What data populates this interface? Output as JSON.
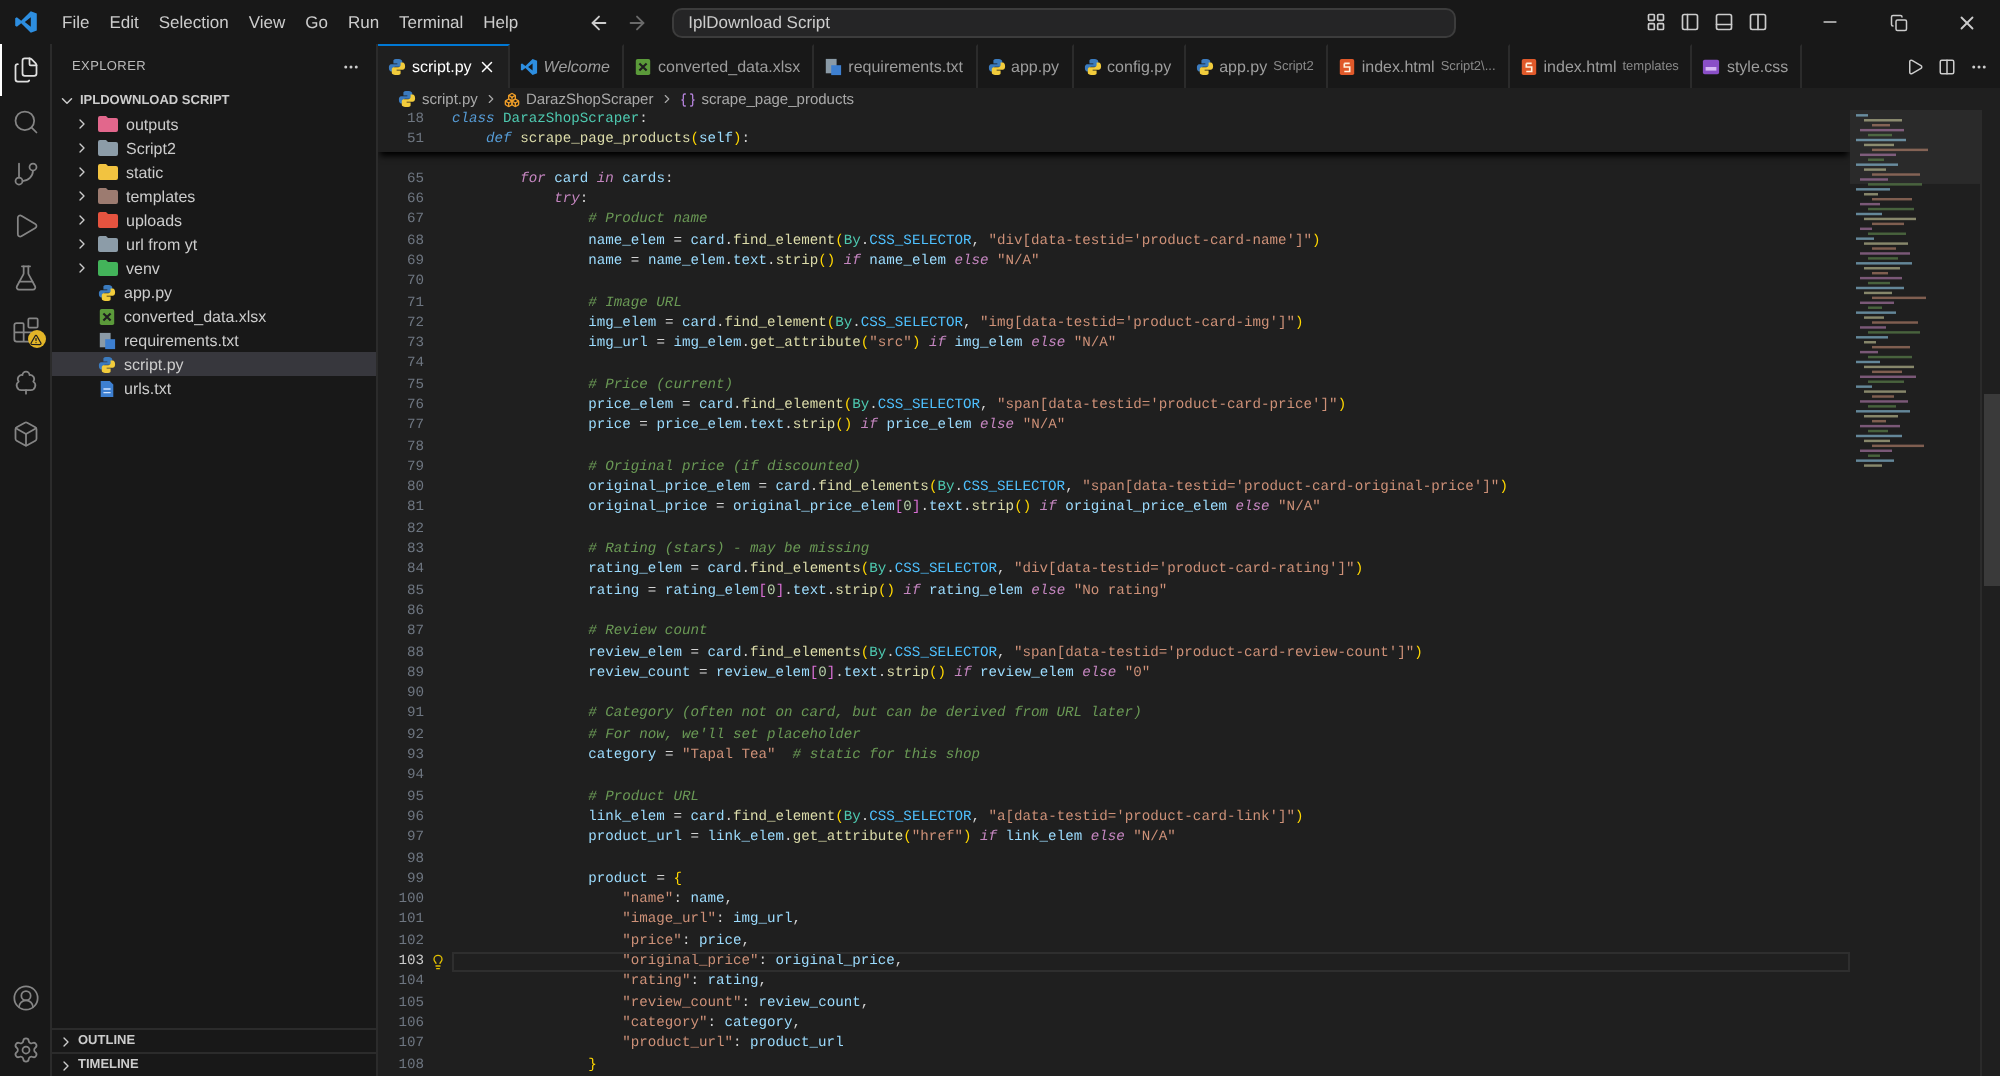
{
  "title_bar": {
    "menu": [
      "File",
      "Edit",
      "Selection",
      "View",
      "Go",
      "Run",
      "Terminal",
      "Help"
    ],
    "search": {
      "value": "IplDownload Script"
    }
  },
  "activity_bar": {
    "items": [
      {
        "kind": "explorer",
        "selected": true,
        "warning": false
      },
      {
        "kind": "search",
        "selected": false,
        "warning": false
      },
      {
        "kind": "source_control",
        "selected": false,
        "warning": false
      },
      {
        "kind": "run",
        "selected": false,
        "warning": false
      },
      {
        "kind": "testing",
        "selected": false,
        "warning": false
      },
      {
        "kind": "extensions",
        "selected": false,
        "warning": true
      },
      {
        "kind": "remote",
        "selected": false,
        "warning": false
      },
      {
        "kind": "packages",
        "selected": false,
        "warning": false
      }
    ],
    "bottom": [
      {
        "kind": "account"
      },
      {
        "kind": "settings"
      }
    ]
  },
  "sidebar": {
    "title": "EXPLORER",
    "root": {
      "label": "IPLDOWNLOAD SCRIPT",
      "expanded": true,
      "children": [
        {
          "label": "outputs",
          "kind": "folder",
          "color": "#e2678c",
          "expanded": false,
          "selected": false
        },
        {
          "label": "Script2",
          "kind": "folder",
          "color": "#8c9ca8",
          "expanded": false,
          "selected": false
        },
        {
          "label": "static",
          "kind": "folder",
          "color": "#f2c340",
          "expanded": false,
          "selected": false
        },
        {
          "label": "templates",
          "kind": "folder",
          "color": "#9c7b70",
          "expanded": false,
          "selected": false
        },
        {
          "label": "uploads",
          "kind": "folder",
          "color": "#e5533f",
          "expanded": false,
          "selected": false
        },
        {
          "label": "url from yt",
          "kind": "folder",
          "color": "#8c9ca8",
          "expanded": false,
          "selected": false
        },
        {
          "label": "venv",
          "kind": "folder",
          "color": "#43b35a",
          "expanded": false,
          "selected": false
        },
        {
          "label": "app.py",
          "kind": "python",
          "selected": false
        },
        {
          "label": "converted_data.xlsx",
          "kind": "sheet",
          "selected": false
        },
        {
          "label": "requirements.txt",
          "kind": "text",
          "selected": false
        },
        {
          "label": "script.py",
          "kind": "python",
          "selected": true
        },
        {
          "label": "urls.txt",
          "kind": "doc",
          "selected": false
        }
      ]
    },
    "sections": [
      {
        "label": "OUTLINE",
        "expanded": false
      },
      {
        "label": "TIMELINE",
        "expanded": false
      }
    ]
  },
  "tabs": [
    {
      "label": "script.py",
      "kind": "python",
      "selected": true,
      "preview": false
    },
    {
      "label": "Welcome",
      "kind": "vscode",
      "selected": false,
      "preview": true
    },
    {
      "label": "converted_data.xlsx",
      "kind": "sheet",
      "selected": false,
      "preview": false
    },
    {
      "label": "requirements.txt",
      "kind": "text",
      "selected": false,
      "preview": false
    },
    {
      "label": "app.py",
      "kind": "python",
      "selected": false,
      "preview": false
    },
    {
      "label": "config.py",
      "kind": "python",
      "selected": false,
      "preview": false
    },
    {
      "label": "app.py",
      "description": "Script2",
      "kind": "python",
      "selected": false,
      "preview": false
    },
    {
      "label": "index.html",
      "description": "Script2\\...",
      "kind": "html",
      "selected": false,
      "preview": false
    },
    {
      "label": "index.html",
      "description": "templates",
      "kind": "html",
      "selected": false,
      "preview": false
    },
    {
      "label": "style.css",
      "kind": "css",
      "selected": false,
      "preview": false
    }
  ],
  "breadcrumb": [
    {
      "label": "script.py",
      "kind": "file"
    },
    {
      "label": "DarazShopScraper",
      "kind": "class"
    },
    {
      "label": "scrape_page_products",
      "kind": "method"
    }
  ],
  "editor": {
    "sticky_lines": [
      {
        "number": "18",
        "tokens": [
          {
            "kind": "st",
            "text": "class"
          },
          {
            "kind": "cls",
            "text": " DarazShopScraper"
          },
          {
            "kind": "p",
            "text": ":"
          }
        ]
      },
      {
        "number": "51",
        "tokens": [
          {
            "kind": "st",
            "text": "    def"
          },
          {
            "kind": "fn",
            "text": " scrape_page_products"
          },
          {
            "kind": "b",
            "text": "("
          },
          {
            "kind": "var",
            "text": "self"
          },
          {
            "kind": "b",
            "text": ")"
          },
          {
            "kind": "p",
            "text": ":"
          }
        ]
      }
    ],
    "lines": [
      {
        "number": "65",
        "current": false,
        "tokens": [
          {
            "kind": "kw",
            "text": "        for"
          },
          {
            "kind": "var",
            "text": " card "
          },
          {
            "kind": "kw",
            "text": "in"
          },
          {
            "kind": "var",
            "text": " cards"
          },
          {
            "kind": "p",
            "text": ":"
          }
        ]
      },
      {
        "number": "66",
        "current": false,
        "tokens": [
          {
            "kind": "kw",
            "text": "            try"
          },
          {
            "kind": "p",
            "text": ":"
          }
        ]
      },
      {
        "number": "67",
        "current": false,
        "tokens": [
          {
            "kind": "c",
            "text": "                # Product name"
          }
        ]
      },
      {
        "number": "68",
        "current": false,
        "tokens": [
          {
            "kind": "var",
            "text": "                name_elem"
          },
          {
            "kind": "p",
            "text": " = "
          },
          {
            "kind": "var",
            "text": "card"
          },
          {
            "kind": "p",
            "text": "."
          },
          {
            "kind": "fn",
            "text": "find_element"
          },
          {
            "kind": "b",
            "text": "("
          },
          {
            "kind": "cls",
            "text": "By"
          },
          {
            "kind": "p",
            "text": "."
          },
          {
            "kind": "const",
            "text": "CSS_SELECTOR"
          },
          {
            "kind": "p",
            "text": ", "
          },
          {
            "kind": "s",
            "text": "\"div[data-testid='product-card-name']\""
          },
          {
            "kind": "b",
            "text": ")"
          }
        ]
      },
      {
        "number": "69",
        "current": false,
        "tokens": [
          {
            "kind": "var",
            "text": "                name"
          },
          {
            "kind": "p",
            "text": " = "
          },
          {
            "kind": "var",
            "text": "name_elem"
          },
          {
            "kind": "p",
            "text": "."
          },
          {
            "kind": "var",
            "text": "text"
          },
          {
            "kind": "p",
            "text": "."
          },
          {
            "kind": "fn",
            "text": "strip"
          },
          {
            "kind": "b",
            "text": "()"
          },
          {
            "kind": "kw",
            "text": " if"
          },
          {
            "kind": "var",
            "text": " name_elem "
          },
          {
            "kind": "kw",
            "text": "else"
          },
          {
            "kind": "s",
            "text": " \"N/A\""
          }
        ]
      },
      {
        "number": "70",
        "current": false
      },
      {
        "number": "71",
        "current": false,
        "tokens": [
          {
            "kind": "c",
            "text": "                # Image URL"
          }
        ]
      },
      {
        "number": "72",
        "current": false,
        "tokens": [
          {
            "kind": "var",
            "text": "                img_elem"
          },
          {
            "kind": "p",
            "text": " = "
          },
          {
            "kind": "var",
            "text": "card"
          },
          {
            "kind": "p",
            "text": "."
          },
          {
            "kind": "fn",
            "text": "find_element"
          },
          {
            "kind": "b",
            "text": "("
          },
          {
            "kind": "cls",
            "text": "By"
          },
          {
            "kind": "p",
            "text": "."
          },
          {
            "kind": "const",
            "text": "CSS_SELECTOR"
          },
          {
            "kind": "p",
            "text": ", "
          },
          {
            "kind": "s",
            "text": "\"img[data-testid='product-card-img']\""
          },
          {
            "kind": "b",
            "text": ")"
          }
        ]
      },
      {
        "number": "73",
        "current": false,
        "tokens": [
          {
            "kind": "var",
            "text": "                img_url"
          },
          {
            "kind": "p",
            "text": " = "
          },
          {
            "kind": "var",
            "text": "img_elem"
          },
          {
            "kind": "p",
            "text": "."
          },
          {
            "kind": "fn",
            "text": "get_attribute"
          },
          {
            "kind": "b",
            "text": "("
          },
          {
            "kind": "s",
            "text": "\"src\""
          },
          {
            "kind": "b",
            "text": ")"
          },
          {
            "kind": "kw",
            "text": " if"
          },
          {
            "kind": "var",
            "text": " img_elem "
          },
          {
            "kind": "kw",
            "text": "else"
          },
          {
            "kind": "s",
            "text": " \"N/A\""
          }
        ]
      },
      {
        "number": "74",
        "current": false
      },
      {
        "number": "75",
        "current": false,
        "tokens": [
          {
            "kind": "c",
            "text": "                # Price (current)"
          }
        ]
      },
      {
        "number": "76",
        "current": false,
        "tokens": [
          {
            "kind": "var",
            "text": "                price_elem"
          },
          {
            "kind": "p",
            "text": " = "
          },
          {
            "kind": "var",
            "text": "card"
          },
          {
            "kind": "p",
            "text": "."
          },
          {
            "kind": "fn",
            "text": "find_element"
          },
          {
            "kind": "b",
            "text": "("
          },
          {
            "kind": "cls",
            "text": "By"
          },
          {
            "kind": "p",
            "text": "."
          },
          {
            "kind": "const",
            "text": "CSS_SELECTOR"
          },
          {
            "kind": "p",
            "text": ", "
          },
          {
            "kind": "s",
            "text": "\"span[data-testid='product-card-price']\""
          },
          {
            "kind": "b",
            "text": ")"
          }
        ]
      },
      {
        "number": "77",
        "current": false,
        "tokens": [
          {
            "kind": "var",
            "text": "                price"
          },
          {
            "kind": "p",
            "text": " = "
          },
          {
            "kind": "var",
            "text": "price_elem"
          },
          {
            "kind": "p",
            "text": "."
          },
          {
            "kind": "var",
            "text": "text"
          },
          {
            "kind": "p",
            "text": "."
          },
          {
            "kind": "fn",
            "text": "strip"
          },
          {
            "kind": "b",
            "text": "()"
          },
          {
            "kind": "kw",
            "text": " if"
          },
          {
            "kind": "var",
            "text": " price_elem "
          },
          {
            "kind": "kw",
            "text": "else"
          },
          {
            "kind": "s",
            "text": " \"N/A\""
          }
        ]
      },
      {
        "number": "78",
        "current": false
      },
      {
        "number": "79",
        "current": false,
        "tokens": [
          {
            "kind": "c",
            "text": "                # Original price (if discounted)"
          }
        ]
      },
      {
        "number": "80",
        "current": false,
        "tokens": [
          {
            "kind": "var",
            "text": "                original_price_elem"
          },
          {
            "kind": "p",
            "text": " = "
          },
          {
            "kind": "var",
            "text": "card"
          },
          {
            "kind": "p",
            "text": "."
          },
          {
            "kind": "fn",
            "text": "find_elements"
          },
          {
            "kind": "b",
            "text": "("
          },
          {
            "kind": "cls",
            "text": "By"
          },
          {
            "kind": "p",
            "text": "."
          },
          {
            "kind": "const",
            "text": "CSS_SELECTOR"
          },
          {
            "kind": "p",
            "text": ", "
          },
          {
            "kind": "s",
            "text": "\"span[data-testid='product-card-original-price']\""
          },
          {
            "kind": "b",
            "text": ")"
          }
        ]
      },
      {
        "number": "81",
        "current": false,
        "tokens": [
          {
            "kind": "var",
            "text": "                original_price"
          },
          {
            "kind": "p",
            "text": " = "
          },
          {
            "kind": "var",
            "text": "original_price_elem"
          },
          {
            "kind": "b2",
            "text": "["
          },
          {
            "kind": "num",
            "text": "0"
          },
          {
            "kind": "b2",
            "text": "]"
          },
          {
            "kind": "p",
            "text": "."
          },
          {
            "kind": "var",
            "text": "text"
          },
          {
            "kind": "p",
            "text": "."
          },
          {
            "kind": "fn",
            "text": "strip"
          },
          {
            "kind": "b",
            "text": "()"
          },
          {
            "kind": "kw",
            "text": " if"
          },
          {
            "kind": "var",
            "text": " original_price_elem "
          },
          {
            "kind": "kw",
            "text": "else"
          },
          {
            "kind": "s",
            "text": " \"N/A\""
          }
        ]
      },
      {
        "number": "82",
        "current": false
      },
      {
        "number": "83",
        "current": false,
        "tokens": [
          {
            "kind": "c",
            "text": "                # Rating (stars) - may be missing"
          }
        ]
      },
      {
        "number": "84",
        "current": false,
        "tokens": [
          {
            "kind": "var",
            "text": "                rating_elem"
          },
          {
            "kind": "p",
            "text": " = "
          },
          {
            "kind": "var",
            "text": "card"
          },
          {
            "kind": "p",
            "text": "."
          },
          {
            "kind": "fn",
            "text": "find_elements"
          },
          {
            "kind": "b",
            "text": "("
          },
          {
            "kind": "cls",
            "text": "By"
          },
          {
            "kind": "p",
            "text": "."
          },
          {
            "kind": "const",
            "text": "CSS_SELECTOR"
          },
          {
            "kind": "p",
            "text": ", "
          },
          {
            "kind": "s",
            "text": "\"div[data-testid='product-card-rating']\""
          },
          {
            "kind": "b",
            "text": ")"
          }
        ]
      },
      {
        "number": "85",
        "current": false,
        "tokens": [
          {
            "kind": "var",
            "text": "                rating"
          },
          {
            "kind": "p",
            "text": " = "
          },
          {
            "kind": "var",
            "text": "rating_elem"
          },
          {
            "kind": "b2",
            "text": "["
          },
          {
            "kind": "num",
            "text": "0"
          },
          {
            "kind": "b2",
            "text": "]"
          },
          {
            "kind": "p",
            "text": "."
          },
          {
            "kind": "var",
            "text": "text"
          },
          {
            "kind": "p",
            "text": "."
          },
          {
            "kind": "fn",
            "text": "strip"
          },
          {
            "kind": "b",
            "text": "()"
          },
          {
            "kind": "kw",
            "text": " if"
          },
          {
            "kind": "var",
            "text": " rating_elem "
          },
          {
            "kind": "kw",
            "text": "else"
          },
          {
            "kind": "s",
            "text": " \"No rating\""
          }
        ]
      },
      {
        "number": "86",
        "current": false
      },
      {
        "number": "87",
        "current": false,
        "tokens": [
          {
            "kind": "c",
            "text": "                # Review count"
          }
        ]
      },
      {
        "number": "88",
        "current": false,
        "tokens": [
          {
            "kind": "var",
            "text": "                review_elem"
          },
          {
            "kind": "p",
            "text": " = "
          },
          {
            "kind": "var",
            "text": "card"
          },
          {
            "kind": "p",
            "text": "."
          },
          {
            "kind": "fn",
            "text": "find_elements"
          },
          {
            "kind": "b",
            "text": "("
          },
          {
            "kind": "cls",
            "text": "By"
          },
          {
            "kind": "p",
            "text": "."
          },
          {
            "kind": "const",
            "text": "CSS_SELECTOR"
          },
          {
            "kind": "p",
            "text": ", "
          },
          {
            "kind": "s",
            "text": "\"span[data-testid='product-card-review-count']\""
          },
          {
            "kind": "b",
            "text": ")"
          }
        ]
      },
      {
        "number": "89",
        "current": false,
        "tokens": [
          {
            "kind": "var",
            "text": "                review_count"
          },
          {
            "kind": "p",
            "text": " = "
          },
          {
            "kind": "var",
            "text": "review_elem"
          },
          {
            "kind": "b2",
            "text": "["
          },
          {
            "kind": "num",
            "text": "0"
          },
          {
            "kind": "b2",
            "text": "]"
          },
          {
            "kind": "p",
            "text": "."
          },
          {
            "kind": "var",
            "text": "text"
          },
          {
            "kind": "p",
            "text": "."
          },
          {
            "kind": "fn",
            "text": "strip"
          },
          {
            "kind": "b",
            "text": "()"
          },
          {
            "kind": "kw",
            "text": " if"
          },
          {
            "kind": "var",
            "text": " review_elem "
          },
          {
            "kind": "kw",
            "text": "else"
          },
          {
            "kind": "s",
            "text": " \"0\""
          }
        ]
      },
      {
        "number": "90",
        "current": false
      },
      {
        "number": "91",
        "current": false,
        "tokens": [
          {
            "kind": "c",
            "text": "                # Category (often not on card, but can be derived from URL later)"
          }
        ]
      },
      {
        "number": "92",
        "current": false,
        "tokens": [
          {
            "kind": "c",
            "text": "                # For now, we'll set placeholder"
          }
        ]
      },
      {
        "number": "93",
        "current": false,
        "tokens": [
          {
            "kind": "var",
            "text": "                category"
          },
          {
            "kind": "p",
            "text": " = "
          },
          {
            "kind": "s",
            "text": "\"Tapal Tea\""
          },
          {
            "kind": "c",
            "text": "  # static for this shop"
          }
        ]
      },
      {
        "number": "94",
        "current": false
      },
      {
        "number": "95",
        "current": false,
        "tokens": [
          {
            "kind": "c",
            "text": "                # Product URL"
          }
        ]
      },
      {
        "number": "96",
        "current": false,
        "tokens": [
          {
            "kind": "var",
            "text": "                link_elem"
          },
          {
            "kind": "p",
            "text": " = "
          },
          {
            "kind": "var",
            "text": "card"
          },
          {
            "kind": "p",
            "text": "."
          },
          {
            "kind": "fn",
            "text": "find_element"
          },
          {
            "kind": "b",
            "text": "("
          },
          {
            "kind": "cls",
            "text": "By"
          },
          {
            "kind": "p",
            "text": "."
          },
          {
            "kind": "const",
            "text": "CSS_SELECTOR"
          },
          {
            "kind": "p",
            "text": ", "
          },
          {
            "kind": "s",
            "text": "\"a[data-testid='product-card-link']\""
          },
          {
            "kind": "b",
            "text": ")"
          }
        ]
      },
      {
        "number": "97",
        "current": false,
        "tokens": [
          {
            "kind": "var",
            "text": "                product_url"
          },
          {
            "kind": "p",
            "text": " = "
          },
          {
            "kind": "var",
            "text": "link_elem"
          },
          {
            "kind": "p",
            "text": "."
          },
          {
            "kind": "fn",
            "text": "get_attribute"
          },
          {
            "kind": "b",
            "text": "("
          },
          {
            "kind": "s",
            "text": "\"href\""
          },
          {
            "kind": "b",
            "text": ")"
          },
          {
            "kind": "kw",
            "text": " if"
          },
          {
            "kind": "var",
            "text": " link_elem "
          },
          {
            "kind": "kw",
            "text": "else"
          },
          {
            "kind": "s",
            "text": " \"N/A\""
          }
        ]
      },
      {
        "number": "98",
        "current": false
      },
      {
        "number": "99",
        "current": false,
        "tokens": [
          {
            "kind": "var",
            "text": "                product"
          },
          {
            "kind": "p",
            "text": " = "
          },
          {
            "kind": "b",
            "text": "{"
          }
        ]
      },
      {
        "number": "100",
        "current": false,
        "tokens": [
          {
            "kind": "s",
            "text": "                    \"name\""
          },
          {
            "kind": "p",
            "text": ": "
          },
          {
            "kind": "var",
            "text": "name"
          },
          {
            "kind": "p",
            "text": ","
          }
        ]
      },
      {
        "number": "101",
        "current": false,
        "tokens": [
          {
            "kind": "s",
            "text": "                    \"image_url\""
          },
          {
            "kind": "p",
            "text": ": "
          },
          {
            "kind": "var",
            "text": "img_url"
          },
          {
            "kind": "p",
            "text": ","
          }
        ]
      },
      {
        "number": "102",
        "current": false,
        "tokens": [
          {
            "kind": "s",
            "text": "                    \"price\""
          },
          {
            "kind": "p",
            "text": ": "
          },
          {
            "kind": "var",
            "text": "price"
          },
          {
            "kind": "p",
            "text": ","
          }
        ]
      },
      {
        "number": "103",
        "current": true,
        "tokens": [
          {
            "kind": "s",
            "text": "                    \"original_price\""
          },
          {
            "kind": "p",
            "text": ": "
          },
          {
            "kind": "var",
            "text": "original_price"
          },
          {
            "kind": "p",
            "text": ","
          }
        ]
      },
      {
        "number": "104",
        "current": false,
        "tokens": [
          {
            "kind": "s",
            "text": "                    \"rating\""
          },
          {
            "kind": "p",
            "text": ": "
          },
          {
            "kind": "var",
            "text": "rating"
          },
          {
            "kind": "p",
            "text": ","
          }
        ]
      },
      {
        "number": "105",
        "current": false,
        "tokens": [
          {
            "kind": "s",
            "text": "                    \"review_count\""
          },
          {
            "kind": "p",
            "text": ": "
          },
          {
            "kind": "var",
            "text": "review_count"
          },
          {
            "kind": "p",
            "text": ","
          }
        ]
      },
      {
        "number": "106",
        "current": false,
        "tokens": [
          {
            "kind": "s",
            "text": "                    \"category\""
          },
          {
            "kind": "p",
            "text": ": "
          },
          {
            "kind": "var",
            "text": "category"
          },
          {
            "kind": "p",
            "text": ","
          }
        ]
      },
      {
        "number": "107",
        "current": false,
        "tokens": [
          {
            "kind": "s",
            "text": "                    \"product_url\""
          },
          {
            "kind": "p",
            "text": ": "
          },
          {
            "kind": "var",
            "text": "product_url"
          }
        ]
      },
      {
        "number": "108",
        "current": false,
        "tokens": [
          {
            "kind": "b",
            "text": "                }"
          }
        ]
      }
    ]
  }
}
